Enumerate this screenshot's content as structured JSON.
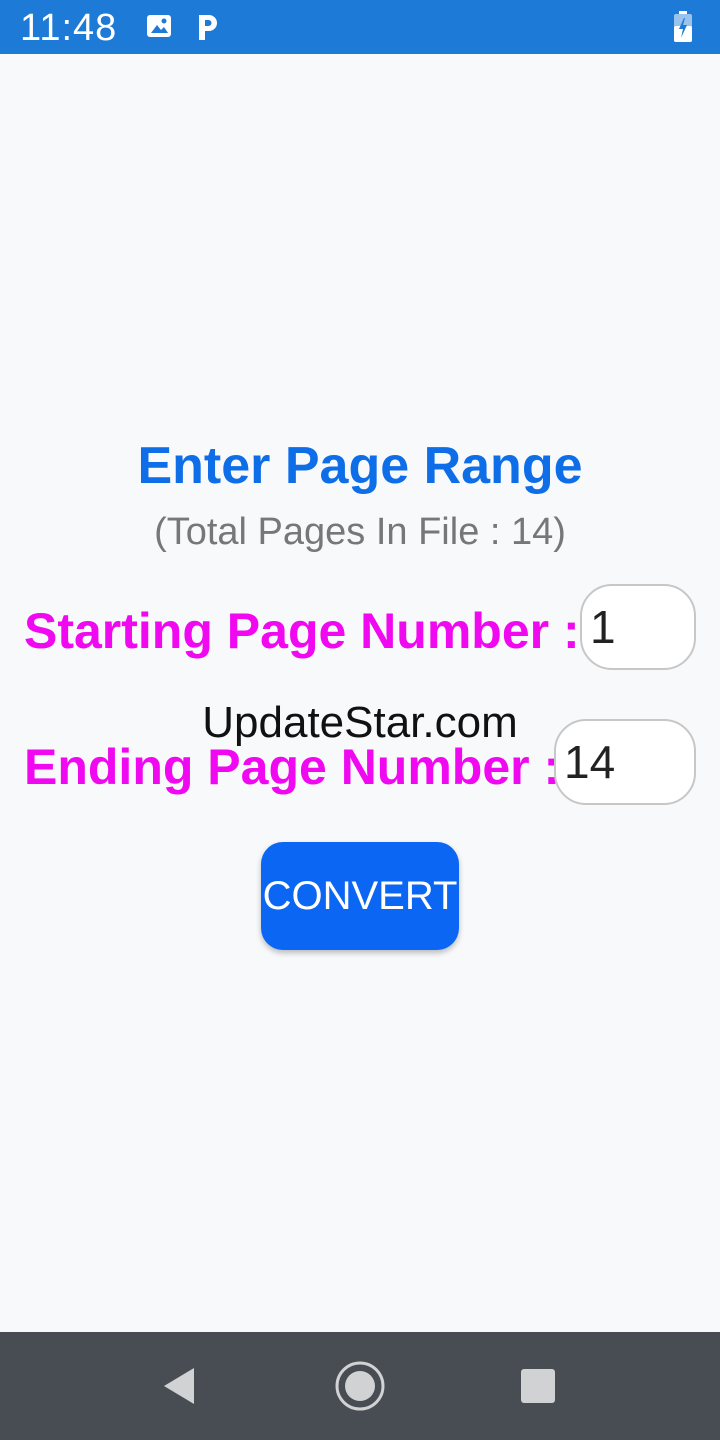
{
  "status_bar": {
    "time": "11:48",
    "icons": [
      "image-icon",
      "parking-icon",
      "battery-charging-icon"
    ],
    "background_color": "#1d7ad6"
  },
  "main": {
    "title": "Enter Page Range",
    "subtitle": "(Total Pages In File : 14)",
    "starting_label": "Starting Page Number :",
    "starting_value": "1",
    "ending_label": "Ending Page Number :",
    "ending_value": "14",
    "watermark": "UpdateStar.com",
    "convert_label": "CONVERT"
  },
  "colors": {
    "title": "#0d6ee8",
    "label": "#f008f0",
    "button": "#0c66f4"
  },
  "nav_bar": {
    "icons": [
      "back-icon",
      "home-icon",
      "recents-icon"
    ]
  }
}
